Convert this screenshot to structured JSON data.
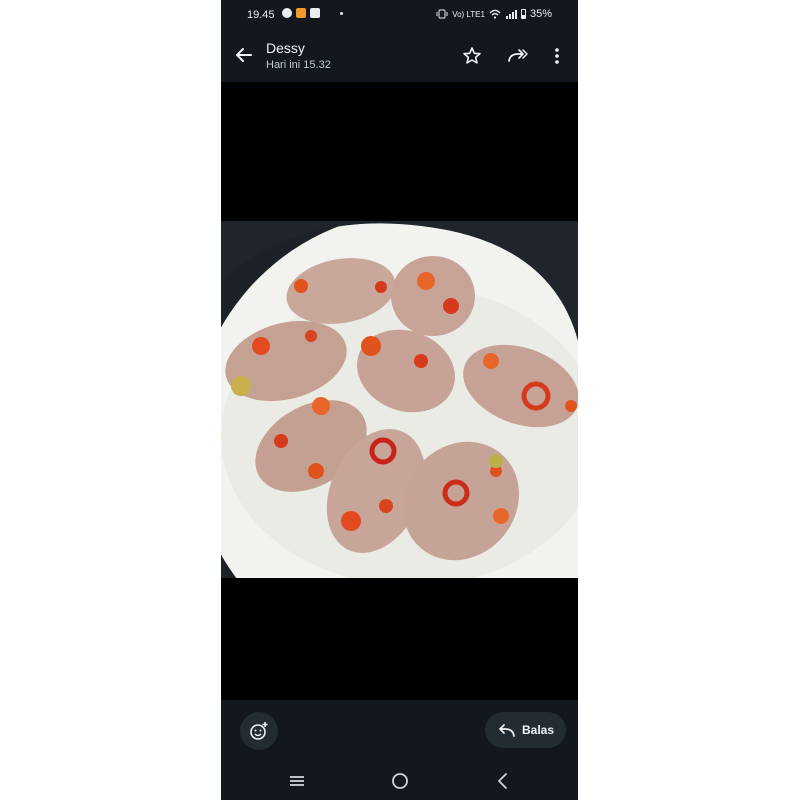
{
  "status_bar": {
    "time": "19.45",
    "network_label": "Vo) LTE1",
    "battery": "35%"
  },
  "header": {
    "sender": "Dessy",
    "timestamp": "Hari ini 15.32"
  },
  "toolbar": {
    "back_icon": "arrow-left-icon",
    "star_icon": "star-outline-icon",
    "forward_icon": "forward-icon",
    "more_icon": "more-vertical-icon"
  },
  "bottom_bar": {
    "emoji_icon": "emoji-add-icon",
    "reply_label": "Balas"
  },
  "nav_bar": {
    "items": [
      "recents-icon",
      "home-icon",
      "back-icon"
    ]
  },
  "colors": {
    "bar_background": "#12181d",
    "button_background": "#232c33",
    "plate": "#f2f2ee",
    "chili_red": "#d63a1c"
  }
}
